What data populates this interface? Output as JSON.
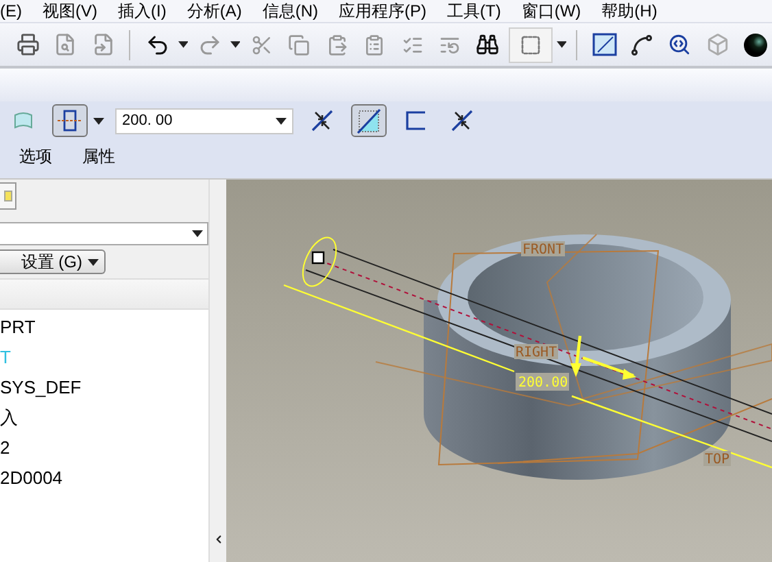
{
  "menu": [
    {
      "label": "(E)"
    },
    {
      "label": "视图(V)"
    },
    {
      "label": "插入(I)"
    },
    {
      "label": "分析(A)"
    },
    {
      "label": "信息(N)"
    },
    {
      "label": "应用程序(P)"
    },
    {
      "label": "工具(T)"
    },
    {
      "label": "窗口(W)"
    },
    {
      "label": "帮助(H)"
    }
  ],
  "dashboard": {
    "tools": [
      {
        "kind": "surface",
        "selected": false
      },
      {
        "kind": "blind",
        "selected": true,
        "caret": true
      },
      {
        "kind": "depth",
        "value": "200. 00"
      },
      {
        "kind": "flip",
        "selected": false
      },
      {
        "kind": "solid",
        "selected": true
      },
      {
        "kind": "thin",
        "selected": false
      },
      {
        "kind": "flip",
        "selected": false
      }
    ],
    "tabs": [
      {
        "label": "选项",
        "selected": false
      },
      {
        "label": "属性",
        "selected": false
      }
    ]
  },
  "model_tree": {
    "settings_button": "设置 (G)",
    "items": [
      {
        "label": "PRT",
        "highlighted": false
      },
      {
        "label": "T",
        "highlighted": true
      },
      {
        "label": "SYS_DEF",
        "highlighted": false
      },
      {
        "label": "入",
        "highlighted": false
      },
      {
        "label": "2",
        "highlighted": false
      },
      {
        "label": "2D0004",
        "highlighted": false
      }
    ]
  },
  "graphics": {
    "planes": [
      {
        "label": "FRONT"
      },
      {
        "label": "RIGHT"
      },
      {
        "label": "TOP"
      }
    ],
    "dimension": "200.00"
  }
}
